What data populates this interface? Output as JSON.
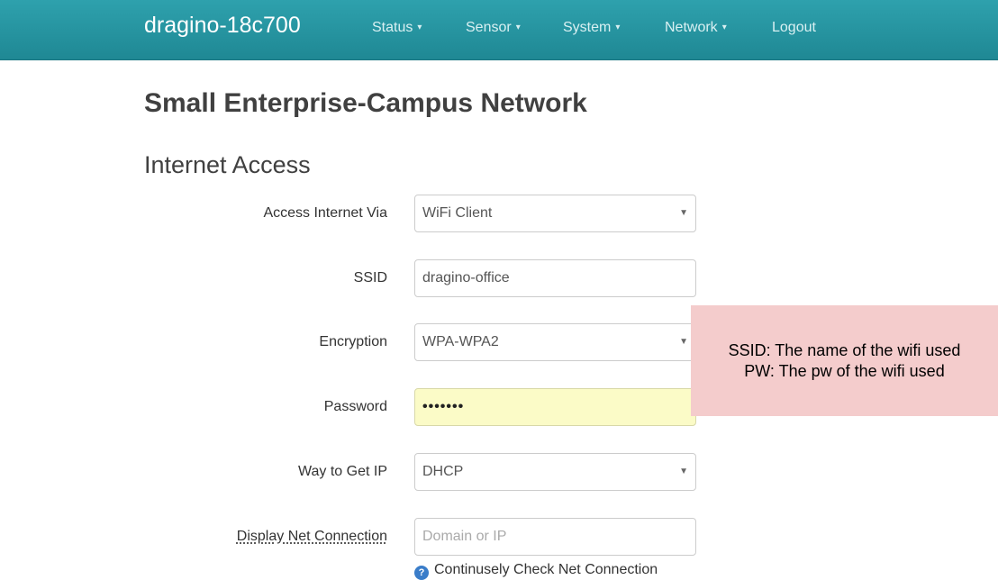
{
  "navbar": {
    "brand": "dragino-18c700",
    "items": [
      {
        "label": "Status",
        "dropdown": true
      },
      {
        "label": "Sensor",
        "dropdown": true
      },
      {
        "label": "System",
        "dropdown": true
      },
      {
        "label": "Network",
        "dropdown": true
      },
      {
        "label": "Logout",
        "dropdown": false
      }
    ],
    "caret": "▾"
  },
  "page": {
    "title": "Small Enterprise-Campus Network",
    "section": "Internet Access"
  },
  "form": {
    "access_via": {
      "label": "Access Internet Via",
      "value": "WiFi Client"
    },
    "ssid": {
      "label": "SSID",
      "value": "dragino-office"
    },
    "encryption": {
      "label": "Encryption",
      "value": "WPA-WPA2"
    },
    "password": {
      "label": "Password",
      "value": "•••••••"
    },
    "way_ip": {
      "label": "Way to Get IP",
      "value": "DHCP"
    },
    "display_net": {
      "label": "Display Net Connection",
      "placeholder": "Domain or IP"
    },
    "help_text": "Continusely Check Net Connection",
    "select_caret": "▼"
  },
  "annotation": {
    "line1": "SSID: The name of the wifi used",
    "line2": "PW: The pw of the wifi used"
  },
  "colors": {
    "navbar": "#2596a2",
    "annotation_bg": "#f4cccc",
    "password_bg": "#fbfbc7"
  },
  "icons": {
    "help": "help-circle-icon",
    "reveal": "reveal-password-icon",
    "select": "chevron-down-icon"
  }
}
